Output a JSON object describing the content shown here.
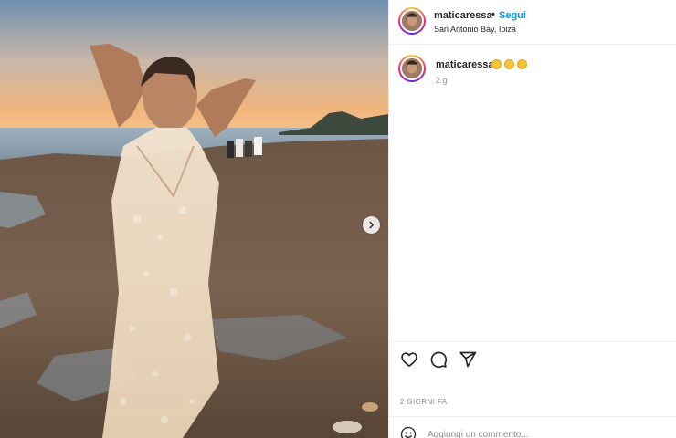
{
  "post": {
    "username": "maticaressa",
    "follow_label": "Segui",
    "separator": "•",
    "location": "San Antonio Bay, Ibiza",
    "date_label": "2 GIORNI FA",
    "icons": {
      "next": "chevron-right-icon",
      "like": "heart-icon",
      "comment": "comment-bubble-icon",
      "share": "paper-plane-icon",
      "emoji": "smiley-icon"
    }
  },
  "caption": {
    "username": "maticaressa",
    "emojis": [
      "sun-emoji",
      "sun-emoji",
      "sun-emoji"
    ],
    "age": "2 g"
  },
  "comment_box": {
    "placeholder": "Aggiungi un commento..."
  },
  "colors": {
    "accent": "#0095f6",
    "text": "#262626",
    "muted": "#8e8e8e",
    "border": "#efefef"
  }
}
